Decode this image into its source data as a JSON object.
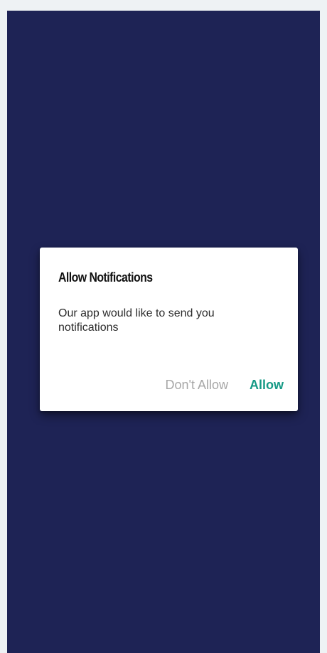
{
  "dialog": {
    "title": "Allow Notifications",
    "message": "Our app would like to send you notifications",
    "deny_label": "Don't Allow",
    "allow_label": "Allow"
  },
  "colors": {
    "page_background": "#eef2f4",
    "screen_background": "#1e2355",
    "dialog_background": "#ffffff",
    "deny_text": "#a7a7a7",
    "allow_text": "#169a86"
  }
}
